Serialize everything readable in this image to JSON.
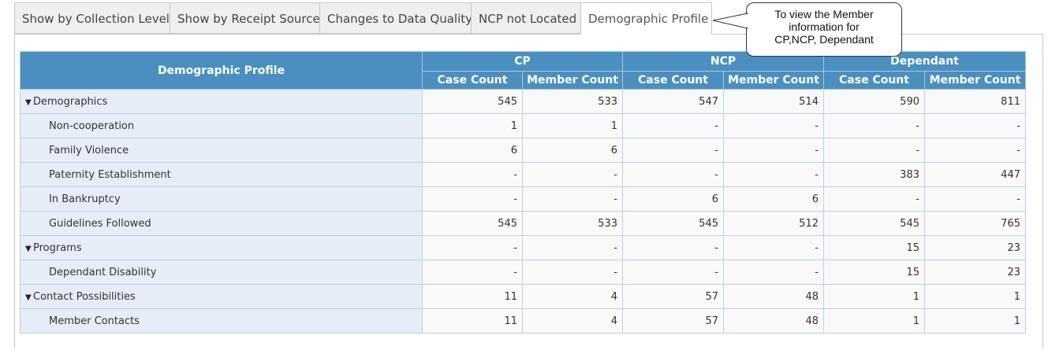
{
  "tabs": [
    {
      "label": "Show by Collection Level"
    },
    {
      "label": "Show by Receipt Source"
    },
    {
      "label": "Changes to Data Quality"
    },
    {
      "label": "NCP not Located"
    },
    {
      "label": "Demographic Profile"
    }
  ],
  "callout": {
    "line1": "To view the Member",
    "line2": "information for",
    "line3": "CP,NCP, Dependant"
  },
  "table": {
    "corner_label": "Demographic Profile",
    "groups": [
      "CP",
      "NCP",
      "Dependant"
    ],
    "subcols": [
      "Case Count",
      "Member Count",
      "Case Count",
      "Member Count",
      "Case Count",
      "Member Count"
    ],
    "rows": [
      {
        "label": "Demographics",
        "caret": "▼",
        "values": [
          "545",
          "533",
          "547",
          "514",
          "590",
          "811"
        ]
      },
      {
        "label": "Non-cooperation",
        "values": [
          "1",
          "1",
          "-",
          "-",
          "-",
          "-"
        ]
      },
      {
        "label": "Family Violence",
        "values": [
          "6",
          "6",
          "-",
          "-",
          "-",
          "-"
        ]
      },
      {
        "label": "Paternity Establishment",
        "values": [
          "-",
          "-",
          "-",
          "-",
          "383",
          "447"
        ]
      },
      {
        "label": "In Bankruptcy",
        "values": [
          "-",
          "-",
          "6",
          "6",
          "-",
          "-"
        ]
      },
      {
        "label": "Guidelines Followed",
        "values": [
          "545",
          "533",
          "545",
          "512",
          "545",
          "765"
        ]
      },
      {
        "label": "Programs",
        "caret": "▼",
        "values": [
          "-",
          "-",
          "-",
          "-",
          "15",
          "23"
        ]
      },
      {
        "label": "Dependant Disability",
        "values": [
          "-",
          "-",
          "-",
          "-",
          "15",
          "23"
        ]
      },
      {
        "label": "Contact Possibilities",
        "caret": "▼",
        "values": [
          "11",
          "4",
          "57",
          "48",
          "1",
          "1"
        ]
      },
      {
        "label": "Member Contacts",
        "values": [
          "11",
          "4",
          "57",
          "48",
          "1",
          "1"
        ]
      }
    ]
  }
}
